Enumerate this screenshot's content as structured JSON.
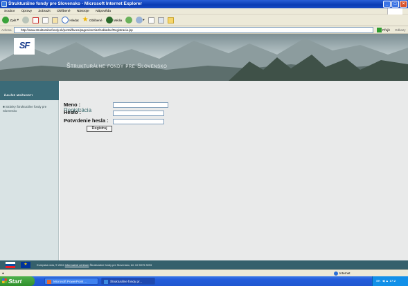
{
  "window": {
    "title": "Štrukturálne fondy pre Slovensko - Microsoft Internet Explorer"
  },
  "menu": [
    "Soubor",
    "Úpravy",
    "Zobrazit",
    "Oblíbené",
    "Nástroje",
    "Nápověda"
  ],
  "toolbar": {
    "back": "Zpět",
    "search": "Hledat",
    "favorites": "Oblíbené",
    "media": "Média"
  },
  "address": {
    "label": "Adresa",
    "url": "http://www.strukturalnefondy.sk/portal/faces/pages/verzia2/zakladne/Registracia.jsp",
    "go": "Přejít",
    "links": "Odkazy"
  },
  "site": {
    "logo": "SF",
    "brand": "Štrukturálne fondy pre Slovensko",
    "nav_header": "ĎALŠIE MOŽNOSTI",
    "nav_link": "Stránky Štrukturálne fondy pre Slovensko"
  },
  "form": {
    "title": "Registrácia",
    "meno": "Meno :",
    "heslo": "Heslo :",
    "potvrdenie": "Potvrdenie hesla :",
    "submit": "Registruj"
  },
  "footer": {
    "pre": "Európska únia, © 2004",
    "link": "Informačné centrum",
    "post": "Štrukturálne fondy pre Slovensko, tel. 02 5975 3093"
  },
  "status": {
    "zone": "Internet"
  },
  "taskbar": {
    "start": "Start",
    "task1": "Microsoft PowerPoint ...",
    "task2": "Štrukturálne fondy pr...",
    "tray": "SK",
    "clock": "17:2"
  },
  "colors": {
    "titlebar": "#0a3cb4",
    "footer": "#35606c",
    "nav_header": "#3b6b78"
  }
}
